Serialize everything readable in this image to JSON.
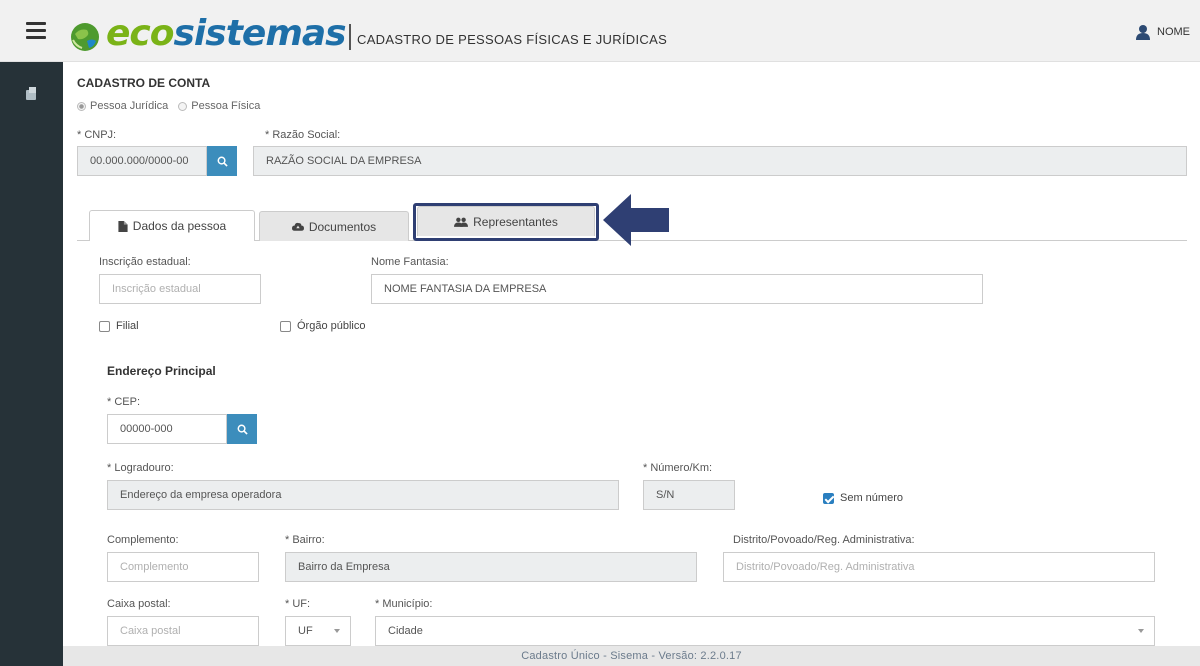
{
  "header": {
    "logo_eco": "eco",
    "logo_sistemas": "sistemas",
    "subtitle": "CADASTRO DE PESSOAS FÍSICAS E JURÍDICAS",
    "user_name": "NOME"
  },
  "form": {
    "title": "CADASTRO DE CONTA",
    "person_type": {
      "options": [
        "Pessoa Jurídica",
        "Pessoa Física"
      ],
      "selected": "Pessoa Jurídica"
    },
    "cnpj": {
      "label": "* CNPJ:",
      "value": "00.000.000/0000-00"
    },
    "razao_social": {
      "label": "* Razão Social:",
      "value": "RAZÃO SOCIAL DA EMPRESA"
    }
  },
  "tabs": [
    {
      "label": "Dados da pessoa",
      "icon": "file-icon",
      "active": true
    },
    {
      "label": "Documentos",
      "icon": "cloud-icon",
      "active": false
    },
    {
      "label": "Representantes",
      "icon": "users-icon",
      "active": false,
      "highlighted": true
    }
  ],
  "dados": {
    "inscricao": {
      "label": "Inscrição estadual:",
      "placeholder": "Inscrição estadual"
    },
    "nome_fantasia": {
      "label": "Nome Fantasia:",
      "value": "NOME FANTASIA DA EMPRESA"
    },
    "filial": {
      "label": "Filial",
      "checked": false
    },
    "orgao_publico": {
      "label": "Órgão público",
      "checked": false
    }
  },
  "endereco": {
    "title": "Endereço Principal",
    "cep": {
      "label": "* CEP:",
      "value": "00000-000"
    },
    "logradouro": {
      "label": "* Logradouro:",
      "value": "Endereço da empresa operadora"
    },
    "numero": {
      "label": "* Número/Km:",
      "value": "S/N"
    },
    "sem_numero": {
      "label": "Sem número",
      "checked": true
    },
    "complemento": {
      "label": "Complemento:",
      "placeholder": "Complemento"
    },
    "bairro": {
      "label": "* Bairro:",
      "value": "Bairro da Empresa"
    },
    "distrito": {
      "label": "Distrito/Povoado/Reg. Administrativa:",
      "placeholder": "Distrito/Povoado/Reg. Administrativa"
    },
    "caixa_postal": {
      "label": "Caixa postal:",
      "placeholder": "Caixa postal"
    },
    "uf": {
      "label": "* UF:",
      "value": "UF"
    },
    "municipio": {
      "label": "* Município:",
      "value": "Cidade"
    }
  },
  "footer": {
    "text": "Cadastro Único - Sisema - Versão: 2.2.0.17"
  },
  "colors": {
    "brand_green": "#7ab317",
    "brand_blue": "#1e6fa8",
    "sidebar": "#263238",
    "search_button": "#3c8dbc",
    "highlight": "#2f3f73"
  }
}
